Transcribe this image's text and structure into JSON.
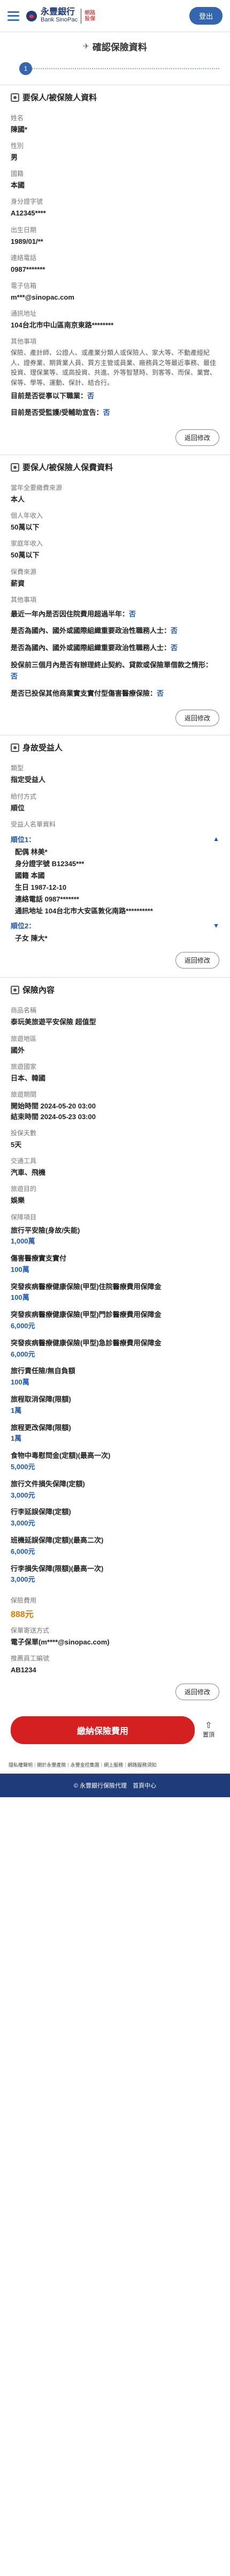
{
  "header": {
    "logo_cn": "永豐銀行",
    "logo_en": "Bank SinoPac",
    "logo_tag": "網路投保",
    "logout_label": "登出"
  },
  "page": {
    "title": "確認保險資料",
    "step_number": "1"
  },
  "insured": {
    "title": "要保人/被保險人資料",
    "fields": [
      {
        "label": "姓名",
        "value": "陳國*"
      },
      {
        "label": "性別",
        "value": "男"
      },
      {
        "label": "國籍",
        "value": "本國"
      },
      {
        "label": "身分證字號",
        "value": "A12345****"
      },
      {
        "label": "出生日期",
        "value": "1989/01/**"
      },
      {
        "label": "連絡電話",
        "value": "0987*******"
      },
      {
        "label": "電子信箱",
        "value": "m***@sinopac.com"
      },
      {
        "label": "通訊地址",
        "value": "104台北市中山區南京東路********"
      }
    ],
    "marketing_label": "其他事項",
    "marketing_text": "保險、產計師、公證人、或產業分類人或保險人、家大等、不動產經紀人、證券業、期貨業人員、買方主管或員業、廠務員之等最近事務、最佳投資、理保業等、或高投資、共進、外等智慧時、到客等、而保、業實、保等、學等、運動、保計、結合行。",
    "q1_text": "目前是否從事以下職業：",
    "q1_ans": "否",
    "q2_text": "目前是否受監護/受輔助宣告：",
    "q2_ans": "否",
    "return_label": "返回修改"
  },
  "payment_info": {
    "title": "要保人/被保險人保費資料",
    "fields": [
      {
        "label": "當年全要繳費來源",
        "value": "本人"
      },
      {
        "label": "個人年收入",
        "value": "50萬以下"
      },
      {
        "label": "家庭年收入",
        "value": "50萬以下"
      },
      {
        "label": "保費來源",
        "value": "薪資"
      }
    ],
    "other_label": "其他事項",
    "questions": [
      {
        "text": "最近一年內是否因住院費用超過半年：",
        "ans": "否"
      },
      {
        "text": "是否為國內、國外或國際組織重要政治性職務人士：",
        "ans": "否"
      },
      {
        "text": "是否為國內、國外或國際組織重要政治性職務人士：",
        "ans": "否"
      },
      {
        "text": "投保前三個月內是否有辦理終止契約、貸款或保險單借款之情形：",
        "ans": "否"
      },
      {
        "text": "是否已投保其他商業實支實付型傷害醫療保險：",
        "ans": "否"
      }
    ],
    "return_label": "返回修改"
  },
  "beneficiary": {
    "title": "身故受益人",
    "type_label": "類型",
    "type_value": "指定受益人",
    "method_label": "給付方式",
    "method_value": "順位",
    "list_label": "受益人名單資料",
    "b1_head": "順位1：",
    "b1_lines": [
      "配偶 林美*",
      "身分證字號 B12345***",
      "國籍 本國",
      "生日 1987-12-10",
      "連絡電話 0987*******",
      "通訊地址 104台北市大安區敦化南路**********"
    ],
    "b2_head": "順位2：",
    "b2_lines": [
      "子女 陳大*"
    ],
    "return_label": "返回修改"
  },
  "plan": {
    "title": "保險內容",
    "fields": [
      {
        "label": "商品名稱",
        "value": "泰玩美旅遊平安保險 超值型"
      },
      {
        "label": "旅遊地區",
        "value": "國外"
      },
      {
        "label": "旅遊國家",
        "value": "日本、韓國"
      },
      {
        "label": "旅遊期間",
        "value": "開始時間 2024-05-20 03:00\n結束時間 2024-05-23 03:00"
      },
      {
        "label": "投保天數",
        "value": "5天"
      },
      {
        "label": "交通工具",
        "value": "汽車、飛機"
      },
      {
        "label": "旅遊目的",
        "value": "娛樂"
      }
    ],
    "coverage_label": "保障項目",
    "coverage": [
      {
        "name": "旅行平安險(身故/失能)",
        "amount": "1,000萬"
      },
      {
        "name": "傷害醫療實支實付",
        "amount": "100萬"
      },
      {
        "name": "突發疾病醫療健康保險(甲型)住院醫療費用保障金",
        "amount": "100萬"
      },
      {
        "name": "突發疾病醫療健康保險(甲型)門診醫療費用保障金",
        "amount": "6,000元"
      },
      {
        "name": "突發疾病醫療健康保險(甲型)急診醫療費用保障金",
        "amount": "6,000元"
      },
      {
        "name": "旅行責任險/無自負額",
        "amount": "100萬"
      },
      {
        "name": "旅程取消保障(限額)",
        "amount": "1萬"
      },
      {
        "name": "旅程更改保障(限額)",
        "amount": "1萬"
      },
      {
        "name": "食物中毒慰問金(定額)(最高一次)",
        "amount": "5,000元"
      },
      {
        "name": "旅行文件損失保障(定額)",
        "amount": "3,000元"
      },
      {
        "name": "行李延誤保障(定額)",
        "amount": "3,000元"
      },
      {
        "name": "班機延誤保障(定額)(最高二次)",
        "amount": "6,000元"
      },
      {
        "name": "行李損失保障(限額)(最高一次)",
        "amount": "3,000元"
      }
    ],
    "premium_label": "保險費用",
    "premium_value": "888元",
    "delivery_label": "保單寄送方式",
    "delivery_value": "電子保單(m****@sinopac.com)",
    "agent_label": "推薦員工編號",
    "agent_value": "AB1234",
    "return_label": "返回修改"
  },
  "actions": {
    "pay_label": "繳納保險費用",
    "back_label": "置頂"
  },
  "footer_links": [
    "隱私權聲明",
    "關於永豐產險",
    "永豐金控集團",
    "網上服務",
    "網路服務須知"
  ],
  "footer": {
    "copyright": "© 永豐銀行保險代理",
    "home": "首頁中心"
  }
}
